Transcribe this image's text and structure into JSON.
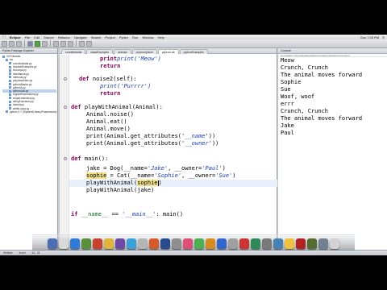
{
  "menubar": {
    "app": "Eclipse",
    "items": [
      "File",
      "Edit",
      "Source",
      "Refactor",
      "Navigate",
      "Search",
      "Project",
      "Pydev",
      "Run",
      "Window",
      "Help"
    ],
    "clock": "Sun 7:05 PM"
  },
  "explorer": {
    "tab": "PyDev Package Explorer",
    "items": [
      {
        "label": "OOTutorials",
        "level": 0
      },
      {
        "label": "src",
        "level": 1
      },
      {
        "label": "countAnimals.py",
        "level": 2
      },
      {
        "label": "functionExamples.py",
        "level": 2
      },
      {
        "label": "forLoops.py",
        "level": 2
      },
      {
        "label": "inheritance.py",
        "level": 2
      },
      {
        "label": "methods.py",
        "level": 2
      },
      {
        "label": "polymorphism.py",
        "level": 2
      },
      {
        "label": "pythonBasics.py",
        "level": 2
      },
      {
        "label": "python3.py",
        "level": 2
      },
      {
        "label": "pythonLab.py",
        "level": 2,
        "selected": true
      },
      {
        "label": "regularExpressions.py",
        "level": 2
      },
      {
        "label": "singleLinkedList.py",
        "level": 2
      },
      {
        "label": "stringFunctions.py",
        "level": 2
      },
      {
        "label": "tutorial.py",
        "level": 2
      },
      {
        "label": "whileLoops.py",
        "level": 2
      },
      {
        "label": "python 2.7 (/System/Library/Frameworks)",
        "level": 1
      }
    ]
  },
  "editor": {
    "tabs": [
      "countAnimals",
      "classExamples",
      "animals",
      "polymorphism",
      "pythonLab",
      "pythonExamples"
    ],
    "active_tab": 4,
    "code_lines": {
      "l1": "print('Meow')",
      "l2": "return",
      "l3a": "def ",
      "l3b": "noise2(self):",
      "l4": "print('Purrrr')",
      "l5": "return",
      "l6a": "def ",
      "l6b": "playWithAnimal(Animal):",
      "l7": "Animal.noise()",
      "l8": "Animal.eat()",
      "l9": "Animal.move()",
      "l10a": "print(Animal.get_attributes('",
      "l10b": "__name",
      "l10c": "'))",
      "l11a": "print(Animal.get_attributes('",
      "l11b": "__owner",
      "l11c": "'))",
      "l12a": "def ",
      "l12b": "main():",
      "l13a": "jake = Dog(__name=",
      "l13b": "'Jake'",
      "l13c": ", __owner=",
      "l13d": "'Paul'",
      "l13e": ")",
      "l14a": "sophie",
      "l14b": " = Cat(__name=",
      "l14c": "'Sophie'",
      "l14d": ", __owner=",
      "l14e": "'Sue'",
      "l14f": ")",
      "l15a": "playWithAnimal(",
      "l15b": "sophie",
      "l15c": ")",
      "l16": "playWithAnimal(jake)",
      "l17a": "if ",
      "l17b": "__name__",
      "l17c": " == ",
      "l17d": "'__main__'",
      "l17e": ": main()"
    }
  },
  "console": {
    "path": "<terminated> /Users/derekbanas/Documents/workspace/pythonLab.py",
    "lines": [
      "Meow",
      "Crunch, Crunch",
      "The animal moves forward",
      "Sophie",
      "Sue",
      "Woof, woof",
      "errr",
      "Crunch, Crunch",
      "The animal moves forward",
      "Jake",
      "Paul"
    ]
  },
  "statusbar": {
    "mode": "Writable",
    "insert": "Insert",
    "position": "54 : 28"
  },
  "dock": {
    "colors": [
      "#4a6fb5",
      "#d9d9d9",
      "#2f7bd6",
      "#5a8f3c",
      "#c9422e",
      "#e0b43a",
      "#6e4aa6",
      "#3aa0d9",
      "#b5b5b5",
      "#d55b2b",
      "#294b8f",
      "#8f8f8f",
      "#e04f7a",
      "#4bb04f",
      "#d88b1f",
      "#3366cc",
      "#a0a0a0",
      "#cc3333",
      "#2e8b57",
      "#7a7a7a",
      "#4682b4",
      "#f0c040",
      "#b22222",
      "#556b2f",
      "#708090",
      "#d3d3d3"
    ]
  }
}
